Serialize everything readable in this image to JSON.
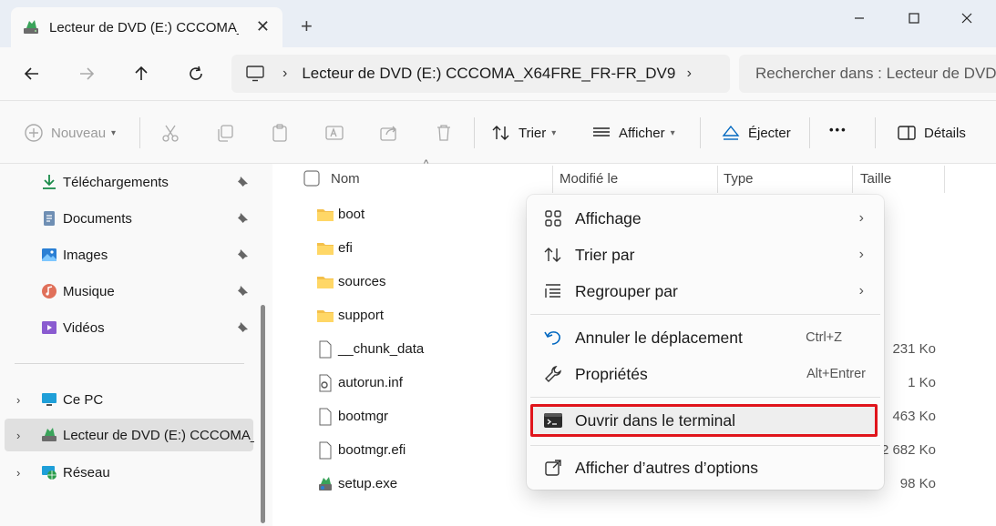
{
  "window": {
    "tab_title": "Lecteur de DVD (E:) CCCOMA_",
    "tab_close": "✕",
    "new_tab": "+",
    "minimize": "—",
    "maximize": "☐",
    "close": "✕"
  },
  "nav": {
    "path": "Lecteur de DVD (E:) CCCOMA_X64FRE_FR-FR_DV9",
    "path_chevron": "›",
    "search_placeholder": "Rechercher dans : Lecteur de DVD"
  },
  "toolbar": {
    "new_label": "Nouveau",
    "sort_label": "Trier",
    "view_label": "Afficher",
    "eject_label": "Éjecter",
    "more_label": "•••",
    "details_label": "Détails"
  },
  "sidebar": {
    "items": [
      {
        "label": "Téléchargements",
        "icon": "download-icon"
      },
      {
        "label": "Documents",
        "icon": "document-icon"
      },
      {
        "label": "Images",
        "icon": "image-icon"
      },
      {
        "label": "Musique",
        "icon": "music-icon"
      },
      {
        "label": "Vidéos",
        "icon": "video-icon"
      },
      {
        "label": "Ce PC",
        "icon": "computer-icon"
      },
      {
        "label": "Lecteur de DVD (E:) CCCOMA_X",
        "icon": "dvd-drive-icon"
      },
      {
        "label": "Réseau",
        "icon": "network-icon"
      }
    ]
  },
  "columns": {
    "name": "Nom",
    "modified": "Modifié le",
    "type": "Type",
    "size": "Taille"
  },
  "files": [
    {
      "name": "boot",
      "kind": "folder",
      "size": ""
    },
    {
      "name": "efi",
      "kind": "folder",
      "size": ""
    },
    {
      "name": "sources",
      "kind": "folder",
      "size": ""
    },
    {
      "name": "support",
      "kind": "folder",
      "size": ""
    },
    {
      "name": "__chunk_data",
      "kind": "file",
      "size": "231 Ko"
    },
    {
      "name": "autorun.inf",
      "kind": "settings-file",
      "size": "1 Ko"
    },
    {
      "name": "bootmgr",
      "kind": "file",
      "size": "463 Ko"
    },
    {
      "name": "bootmgr.efi",
      "kind": "file",
      "size": "2 682 Ko"
    },
    {
      "name": "setup.exe",
      "kind": "exe",
      "size": "98 Ko"
    }
  ],
  "context_menu": {
    "view": "Affichage",
    "sort_by": "Trier par",
    "group_by": "Regrouper par",
    "undo_move": "Annuler le déplacement",
    "undo_shortcut": "Ctrl+Z",
    "properties": "Propriétés",
    "properties_shortcut": "Alt+Entrer",
    "open_terminal": "Ouvrir dans le terminal",
    "more_options": "Afficher d’autres d’options",
    "submenu_chevron": "›"
  },
  "colors": {
    "accent": "#0067c0",
    "highlight_border": "#e0141b",
    "folder": "#f4c04a"
  }
}
